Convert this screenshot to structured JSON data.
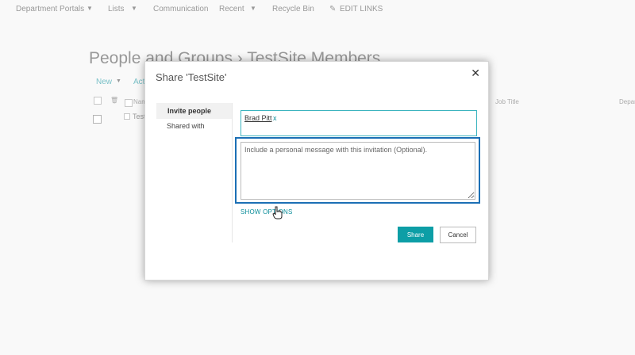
{
  "topnav": {
    "items": [
      "Department Portals",
      "Lists",
      "Communication",
      "Recent",
      "Recycle Bin"
    ],
    "edit_links": "EDIT LINKS"
  },
  "page": {
    "title": "People and Groups › TestSite Members",
    "new_label": "New",
    "actions_label": "Act",
    "columns": {
      "name": "Nam",
      "job_title": "Job Title",
      "department": "Depar"
    },
    "row_name": "Test"
  },
  "dialog": {
    "title": "Share 'TestSite'",
    "close_glyph": "✕",
    "tabs": [
      "Invite people",
      "Shared with"
    ],
    "invitee": {
      "name": "Brad Pitt",
      "remove": "x"
    },
    "message_placeholder": "Include a personal message with this invitation (Optional).",
    "show_options": "SHOW OPTIONS",
    "share_label": "Share",
    "cancel_label": "Cancel"
  },
  "colors": {
    "accent": "#0d9ea6",
    "highlight": "#1b6fb5",
    "link": "#0a8d9a"
  }
}
